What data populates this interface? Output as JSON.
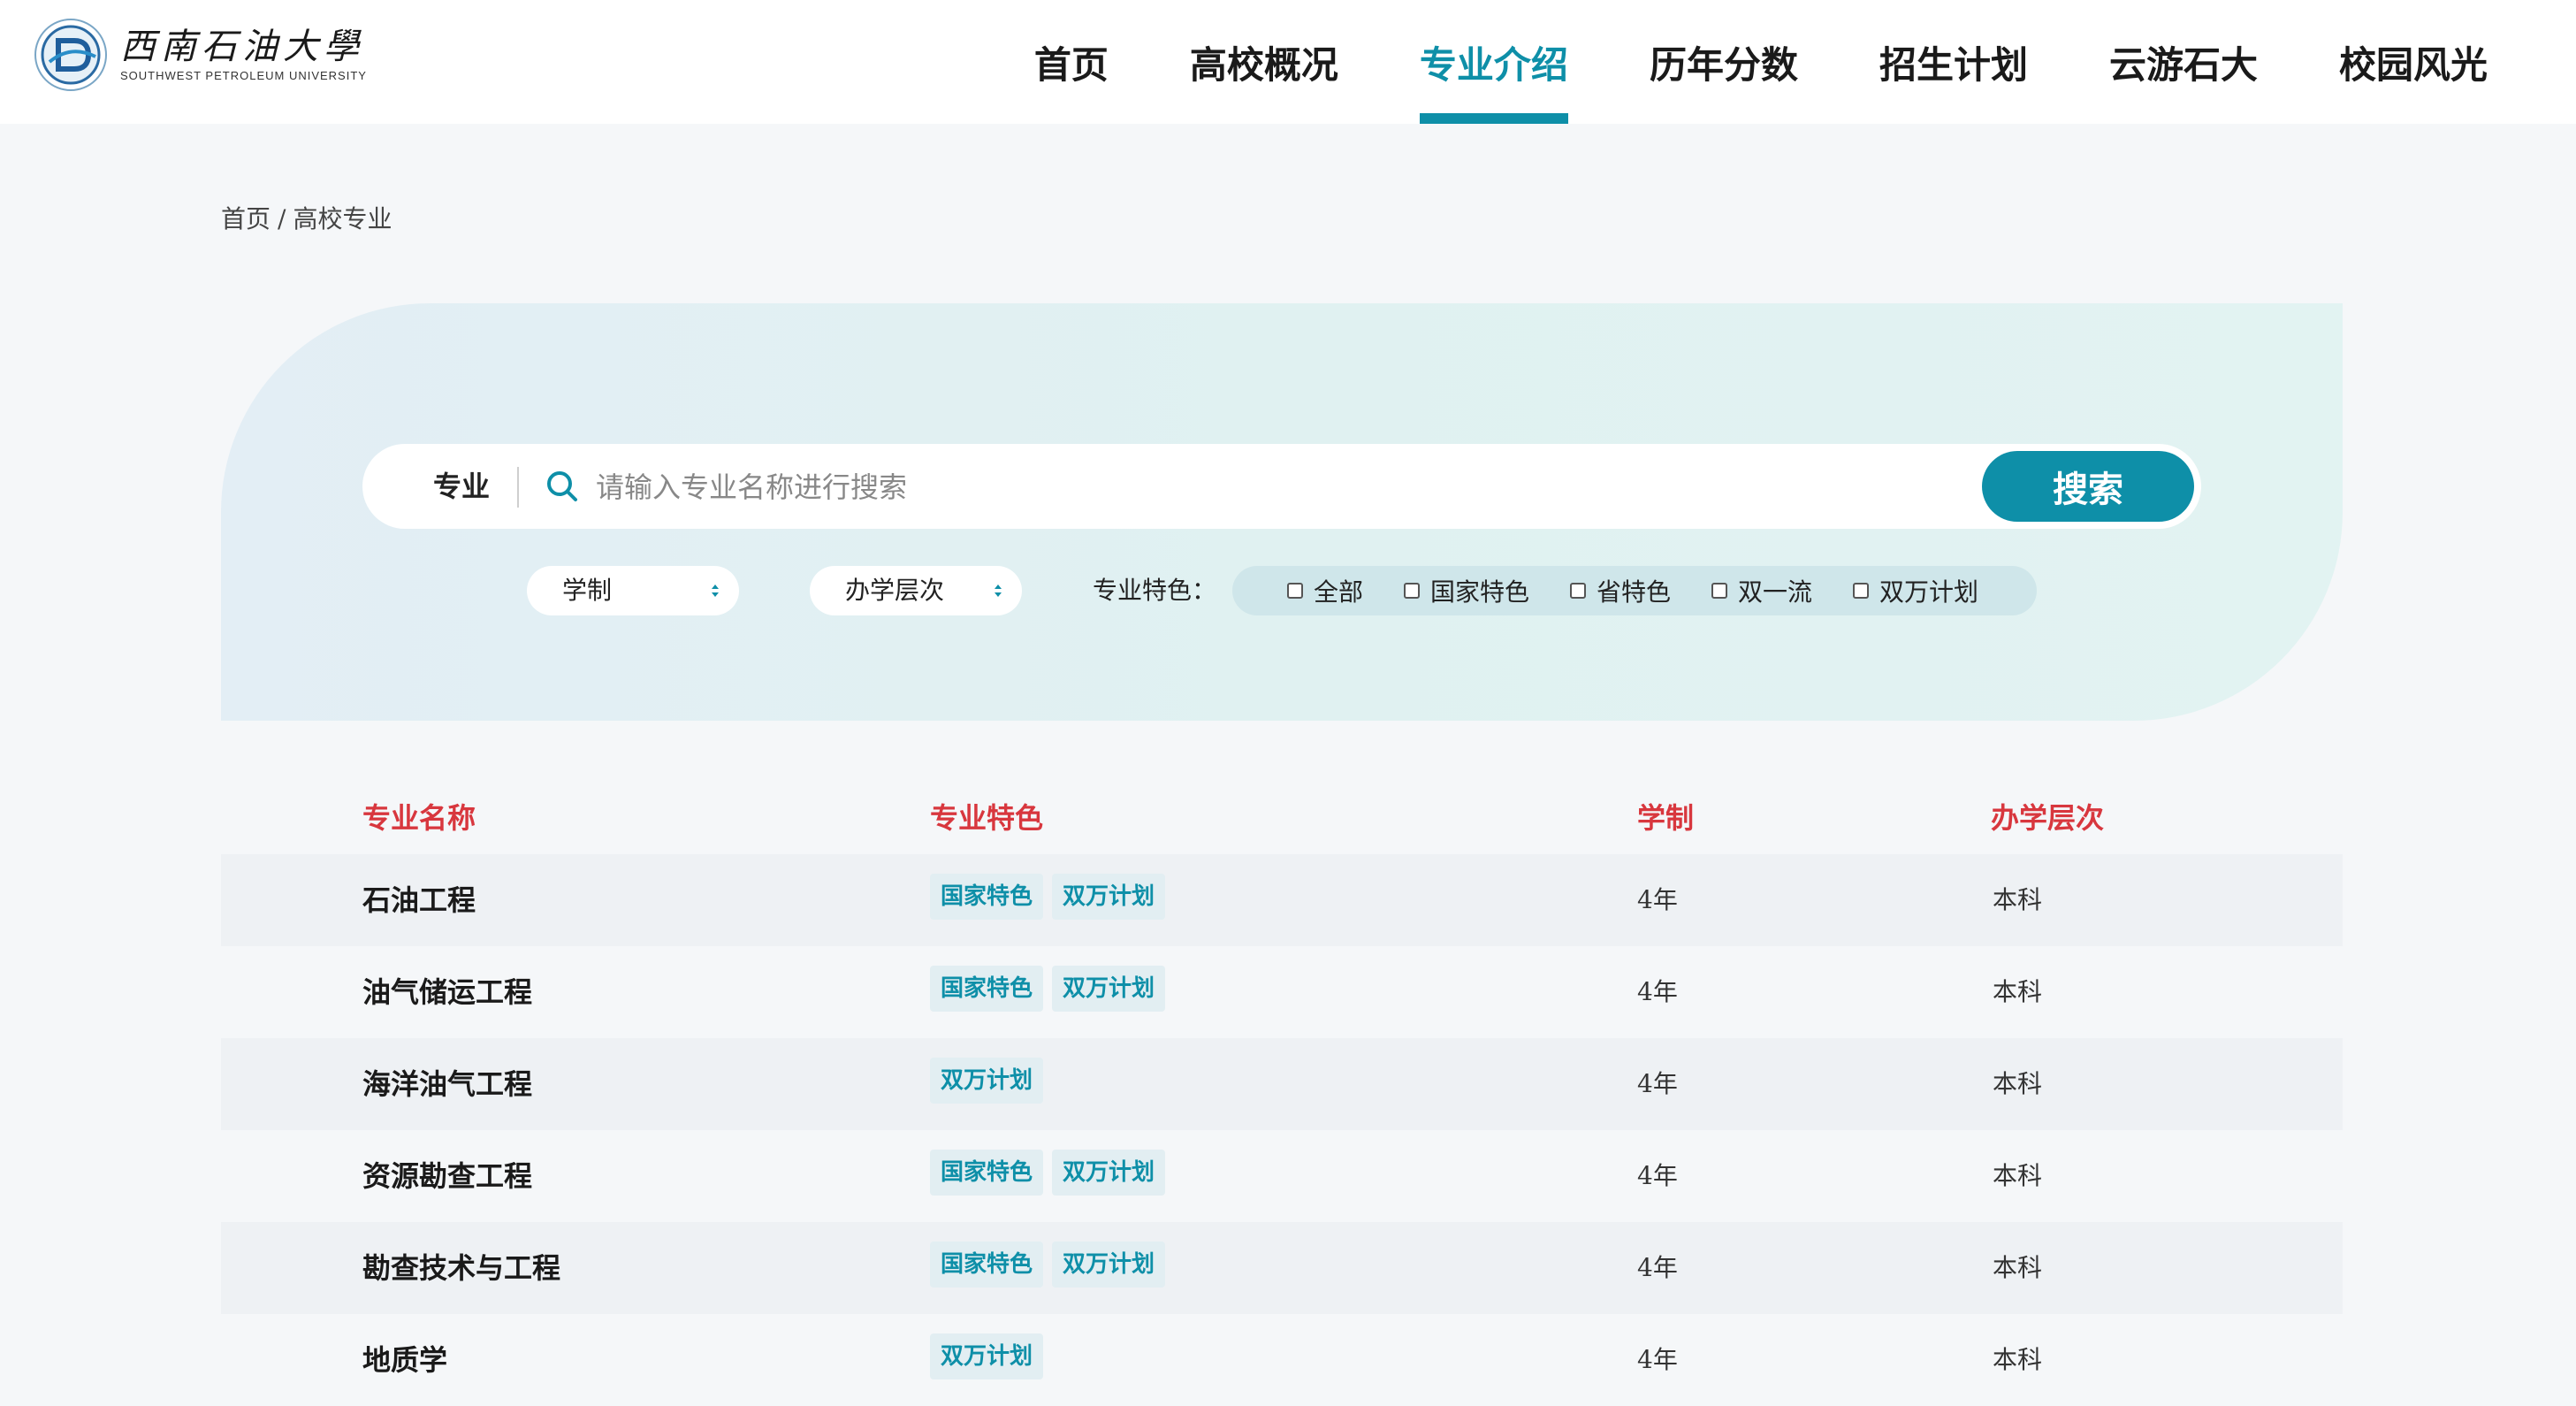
{
  "header": {
    "logo_cn": "西南石油大學",
    "logo_en": "SOUTHWEST PETROLEUM UNIVERSITY",
    "nav": [
      {
        "label": "首页",
        "active": false
      },
      {
        "label": "高校概况",
        "active": false
      },
      {
        "label": "专业介绍",
        "active": true
      },
      {
        "label": "历年分数",
        "active": false
      },
      {
        "label": "招生计划",
        "active": false
      },
      {
        "label": "云游石大",
        "active": false
      },
      {
        "label": "校园风光",
        "active": false
      }
    ]
  },
  "breadcrumb": {
    "home": "首页",
    "separator": "/",
    "current": "高校专业"
  },
  "search": {
    "category": "专业",
    "placeholder": "请输入专业名称进行搜索",
    "value": "",
    "button": "搜索"
  },
  "filters": {
    "duration_select": "学制",
    "level_select": "办学层次",
    "feature_label": "专业特色：",
    "features": [
      {
        "label": "全部",
        "checked": false
      },
      {
        "label": "国家特色",
        "checked": false
      },
      {
        "label": "省特色",
        "checked": false
      },
      {
        "label": "双一流",
        "checked": false
      },
      {
        "label": "双万计划",
        "checked": false
      }
    ]
  },
  "table": {
    "headers": [
      "专业名称",
      "专业特色",
      "学制",
      "办学层次"
    ],
    "rows": [
      {
        "name": "石油工程",
        "tags": [
          "国家特色",
          "双万计划"
        ],
        "duration": "4年",
        "level": "本科"
      },
      {
        "name": "油气储运工程",
        "tags": [
          "国家特色",
          "双万计划"
        ],
        "duration": "4年",
        "level": "本科"
      },
      {
        "name": "海洋油气工程",
        "tags": [
          "双万计划"
        ],
        "duration": "4年",
        "level": "本科"
      },
      {
        "name": "资源勘查工程",
        "tags": [
          "国家特色",
          "双万计划"
        ],
        "duration": "4年",
        "level": "本科"
      },
      {
        "name": "勘查技术与工程",
        "tags": [
          "国家特色",
          "双万计划"
        ],
        "duration": "4年",
        "level": "本科"
      },
      {
        "name": "地质学",
        "tags": [
          "双万计划"
        ],
        "duration": "4年",
        "level": "本科"
      }
    ]
  },
  "colors": {
    "accent": "#0e8fa8",
    "header_red": "#d8373e",
    "page_bg": "#f5f7f9"
  }
}
